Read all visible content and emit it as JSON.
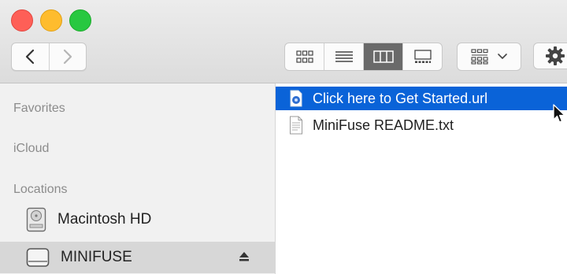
{
  "window": {
    "buttons": [
      "close",
      "minimize",
      "zoom"
    ]
  },
  "toolbar": {
    "nav": {
      "back_icon": "chevron-left",
      "forward_icon": "chevron-right"
    },
    "views": [
      {
        "name": "icon-view",
        "icon": "grid-icon",
        "active": false
      },
      {
        "name": "list-view",
        "icon": "list-icon",
        "active": false
      },
      {
        "name": "column-view",
        "icon": "columns-icon",
        "active": true
      },
      {
        "name": "gallery-view",
        "icon": "gallery-icon",
        "active": false
      }
    ],
    "group": {
      "icon": "group-grid-icon",
      "dropdown": "chevron-down-icon"
    },
    "action": {
      "icon": "gear-icon"
    }
  },
  "sidebar": {
    "headings": {
      "favorites": "Favorites",
      "icloud": "iCloud",
      "locations": "Locations"
    },
    "locations": [
      {
        "label": "Macintosh HD",
        "icon": "internal-disk-icon",
        "selected": false
      },
      {
        "label": "MINIFUSE",
        "icon": "external-disk-icon",
        "selected": true,
        "eject": "eject-icon"
      }
    ]
  },
  "files": [
    {
      "name": "Click here to Get Started.url",
      "icon": "url-file-icon",
      "selected": true
    },
    {
      "name": "MiniFuse README.txt",
      "icon": "text-file-icon",
      "selected": false
    }
  ],
  "colors": {
    "selection_blue": "#0a63d8",
    "sidebar_bg": "#f1f1f1",
    "sidebar_selected": "#d7d7d7",
    "close": "#fe5f57",
    "minimize": "#febc2e",
    "zoom": "#28c840"
  }
}
